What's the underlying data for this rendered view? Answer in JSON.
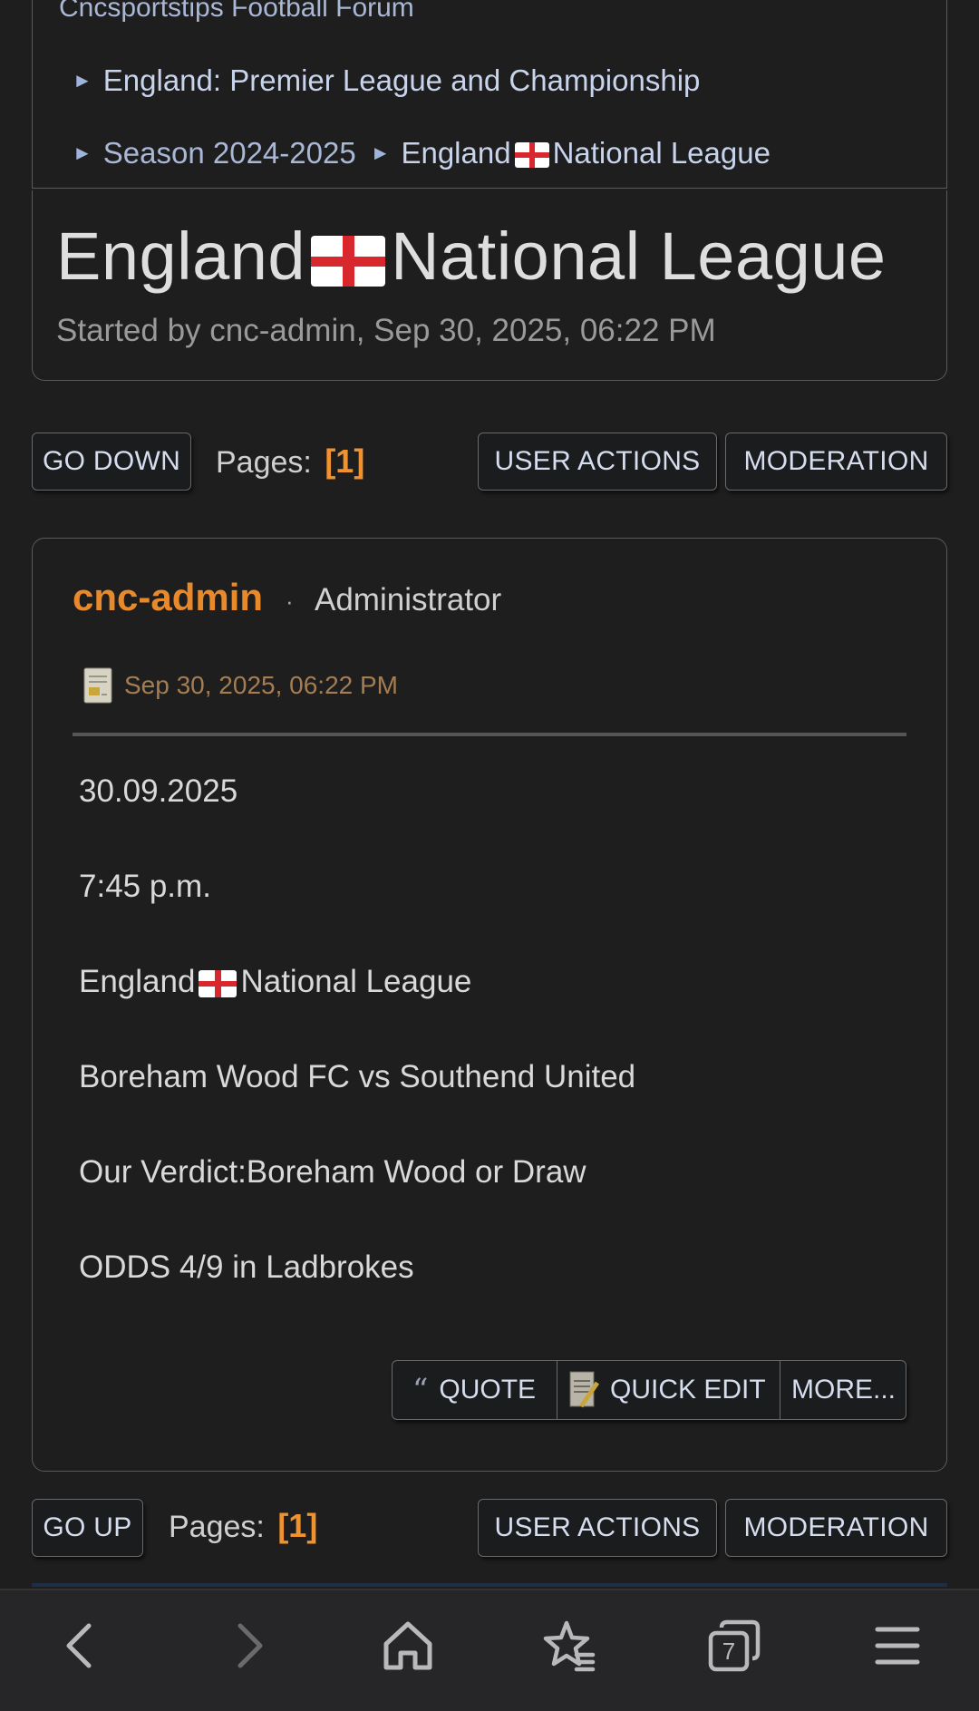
{
  "breadcrumb": {
    "forum": "Cncsportstips Football Forum",
    "board": "England: Premier League and Championship",
    "season": "Season 2024-2025",
    "topic_prefix": "England",
    "topic_suffix": "National League"
  },
  "topic": {
    "title_prefix": "England",
    "title_suffix": "National League",
    "started_by": "Started by cnc-admin, Sep 30, 2025, 06:22 PM"
  },
  "top_bar": {
    "go_down": "GO DOWN",
    "pages_label": "Pages:",
    "pages_value": "[1]",
    "user_actions": "USER ACTIONS",
    "moderation": "MODERATION"
  },
  "post": {
    "author": "cnc-admin",
    "separator": "·",
    "role": "Administrator",
    "date": "Sep 30, 2025, 06:22 PM",
    "lines": {
      "date": "30.09.2025",
      "time": "7:45 p.m.",
      "league_prefix": "England",
      "league_suffix": "National League",
      "match": "Boreham Wood FC vs Southend United",
      "verdict": "Our Verdict:Boreham Wood or Draw",
      "odds": "ODDS 4/9 in Ladbrokes"
    },
    "actions": {
      "quote": "QUOTE",
      "quick_edit": "QUICK EDIT",
      "more": "MORE..."
    }
  },
  "bottom_bar_controls": {
    "go_up": "GO UP",
    "pages_label": "Pages:",
    "pages_value": "[1]",
    "user_actions": "USER ACTIONS",
    "moderation": "MODERATION"
  },
  "browser_nav": {
    "icons": [
      "back-icon",
      "forward-icon",
      "home-icon",
      "bookmarks-icon",
      "tabs-icon",
      "menu-icon"
    ],
    "tab_count": "7"
  },
  "colors": {
    "background": "#1e1e1f",
    "accent_orange": "#e8892b",
    "link_blue": "#c8d4ec",
    "flag_red": "#d8282d"
  }
}
